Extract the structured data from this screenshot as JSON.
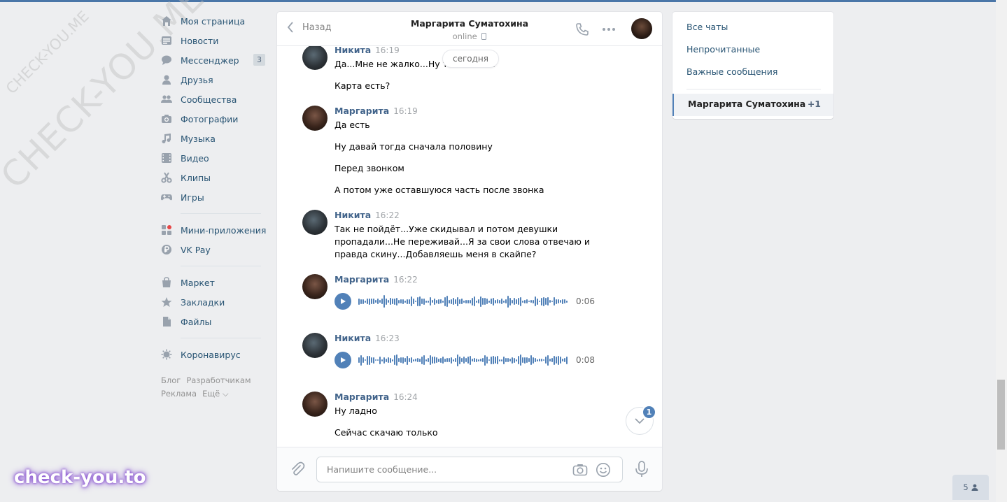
{
  "nav": {
    "items": [
      {
        "label": "Моя страница",
        "icon": "home-icon"
      },
      {
        "label": "Новости",
        "icon": "news-icon"
      },
      {
        "label": "Мессенджер",
        "icon": "messenger-icon",
        "badge": "3"
      },
      {
        "label": "Друзья",
        "icon": "friends-icon"
      },
      {
        "label": "Сообщества",
        "icon": "communities-icon"
      },
      {
        "label": "Фотографии",
        "icon": "camera-icon"
      },
      {
        "label": "Музыка",
        "icon": "music-icon"
      },
      {
        "label": "Видео",
        "icon": "video-icon"
      },
      {
        "label": "Клипы",
        "icon": "clips-icon"
      },
      {
        "label": "Игры",
        "icon": "gamepad-icon"
      }
    ],
    "items2": [
      {
        "label": "Мини-приложения",
        "icon": "apps-icon"
      },
      {
        "label": "VK Pay",
        "icon": "vkpay-icon"
      }
    ],
    "items3": [
      {
        "label": "Маркет",
        "icon": "market-icon"
      },
      {
        "label": "Закладки",
        "icon": "star-icon"
      },
      {
        "label": "Файлы",
        "icon": "file-icon"
      }
    ],
    "items4": [
      {
        "label": "Коронавирус",
        "icon": "virus-icon"
      }
    ],
    "footer": [
      "Блог",
      "Разработчикам",
      "Реклама",
      "Ещё ⌵"
    ]
  },
  "chat": {
    "back_label": "Назад",
    "title": "Маргарита Суматохина",
    "status": "online",
    "date_chip": "сегодня",
    "messages": [
      {
        "author": "Никита",
        "time": "16:19",
        "lines": [
          "Да...Мне не жалко...Ну так и ... на?",
          "Карта есть?"
        ]
      },
      {
        "author": "Маргарита",
        "time": "16:19",
        "lines": [
          "Да есть",
          "Ну давай тогда сначала половину",
          "Перед звонком",
          "А потом уже оставшуюся часть после звонка"
        ]
      },
      {
        "author": "Никита",
        "time": "16:22",
        "lines": [
          "Так не пойдёт...Уже скидывал и потом девушки пропадали...Не переживай...Я за свои слова отвечаю и правда скину...Добавляешь меня в скайпе?"
        ]
      },
      {
        "author": "Маргарита",
        "time": "16:22",
        "voice_duration": "0:06"
      },
      {
        "author": "Никита",
        "time": "16:23",
        "voice_duration": "0:08"
      },
      {
        "author": "Маргарита",
        "time": "16:24",
        "lines": [
          "Ну ладно",
          "Сейчас скачаю только"
        ]
      }
    ],
    "unread_badge": "1",
    "compose_placeholder": "Напишите сообщение..."
  },
  "right": {
    "filters": [
      "Все чаты",
      "Непрочитанные",
      "Важные сообщения"
    ],
    "active_chat": "Маргарита Суматохина",
    "active_count": "+1"
  },
  "tray_count": "5",
  "watermarks": [
    "CHECK-YOU.ME",
    "CHECK-YOU.ME",
    "check-you.to"
  ],
  "colors": {
    "accent": "#5181b8",
    "link": "#285473",
    "author": "#42648b",
    "background": "#edeef0"
  }
}
